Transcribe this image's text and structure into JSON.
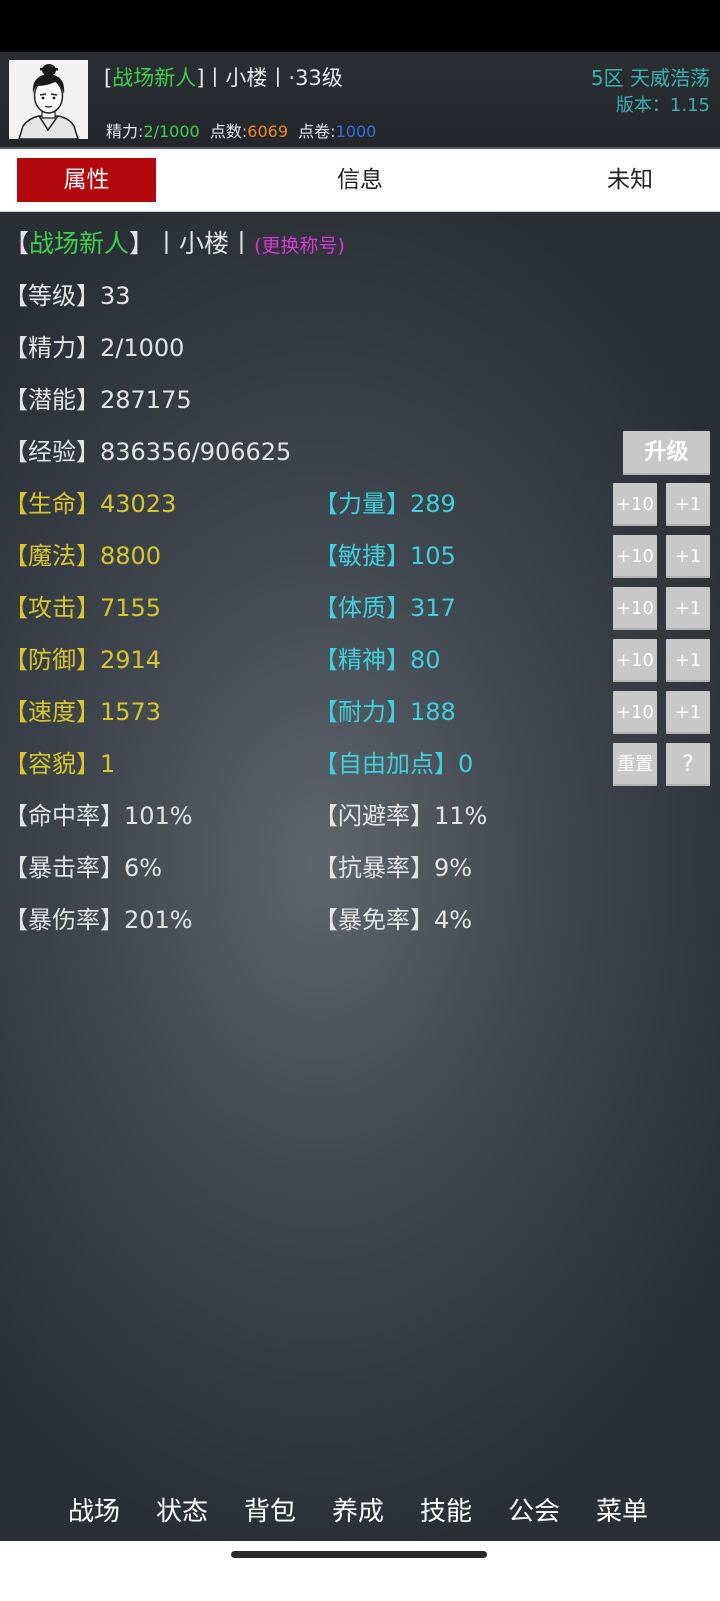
{
  "header": {
    "name_open": "[",
    "name_title": "战场新人",
    "name_rest": "]丨小楼丨·33级",
    "energy_label": "精力:",
    "energy_value": "2/1000",
    "points_label": "点数:",
    "points_value": "6069",
    "scrolls_label": "点卷:",
    "scrolls_value": "1000",
    "server": "5区 天威浩荡",
    "version": "版本：1.15"
  },
  "tabs": [
    {
      "label": "属性",
      "active": true
    },
    {
      "label": "信息",
      "active": false
    },
    {
      "label": "未知",
      "active": false
    }
  ],
  "title_row": {
    "open": "【",
    "title": "战场新人",
    "close": "】",
    "name": "丨小楼丨",
    "change": "(更换称号)"
  },
  "basic": {
    "level": "【等级】33",
    "energy": "【精力】2/1000",
    "potential": "【潜能】287175",
    "exp": "【经验】836356/906625",
    "upgrade_button": "升级"
  },
  "stats_left": [
    "【生命】43023",
    "【魔法】8800",
    "【攻击】7155",
    "【防御】2914",
    "【速度】1573",
    "【容貌】1"
  ],
  "stats_right": [
    "【力量】289",
    "【敏捷】105",
    "【体质】317",
    "【精神】80",
    "【耐力】188",
    "【自由加点】0"
  ],
  "add_buttons": {
    "plus10": "+10",
    "plus1": "+1",
    "reset": "重置",
    "help": "?"
  },
  "rates_left": [
    "【命中率】101%",
    "【暴击率】6%",
    "【暴伤率】201%"
  ],
  "rates_right": [
    "【闪避率】11%",
    "【抗暴率】9%",
    "【暴免率】4%"
  ],
  "bottom_nav": [
    "战场",
    "状态",
    "背包",
    "养成",
    "技能",
    "公会",
    "菜单"
  ],
  "colors": {
    "accent_red": "#b3080c",
    "title_green": "#3ecf4c",
    "stat_yellow": "#d7c52c",
    "stat_cyan": "#3fd0dc",
    "server_teal": "#39b3b0"
  }
}
